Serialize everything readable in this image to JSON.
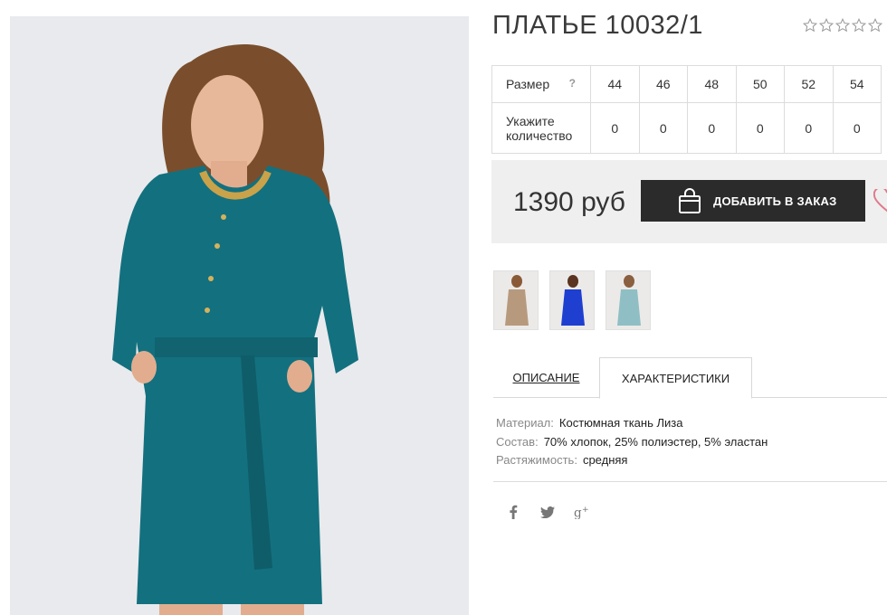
{
  "product": {
    "title": "ПЛАТЬЕ 10032/1",
    "rating": {
      "value": 0,
      "max": 5
    }
  },
  "size_table": {
    "size_label": "Размер",
    "size_hint": "?",
    "qty_label_line1": "Укажите",
    "qty_label_line2": "количество",
    "sizes": [
      "44",
      "46",
      "48",
      "50",
      "52",
      "54"
    ],
    "quantities": [
      "0",
      "0",
      "0",
      "0",
      "0",
      "0"
    ]
  },
  "buy": {
    "price": "1390 руб",
    "add_label": "ДОБАВИТЬ В ЗАКАЗ"
  },
  "thumbnails": [
    {
      "color": "#b79a7e"
    },
    {
      "color": "#1f3fd0"
    },
    {
      "color": "#8fbfc4"
    }
  ],
  "tabs": [
    {
      "label": "ОПИСАНИЕ"
    },
    {
      "label": "ХАРАКТЕРИСТИКИ"
    }
  ],
  "specs": [
    {
      "key": "Материал:",
      "value": "Костюмная ткань Лиза"
    },
    {
      "key": "Состав:",
      "value": "70% хлопок, 25% полиэстер, 5% эластан"
    },
    {
      "key": "Растяжимость:",
      "value": "средняя"
    }
  ],
  "social": [
    "facebook-icon",
    "twitter-icon",
    "google-plus-icon"
  ],
  "colors": {
    "dress": "#13707f",
    "button": "#2b2b2b",
    "buybox": "#efefef",
    "heart": "#e07a8a"
  }
}
